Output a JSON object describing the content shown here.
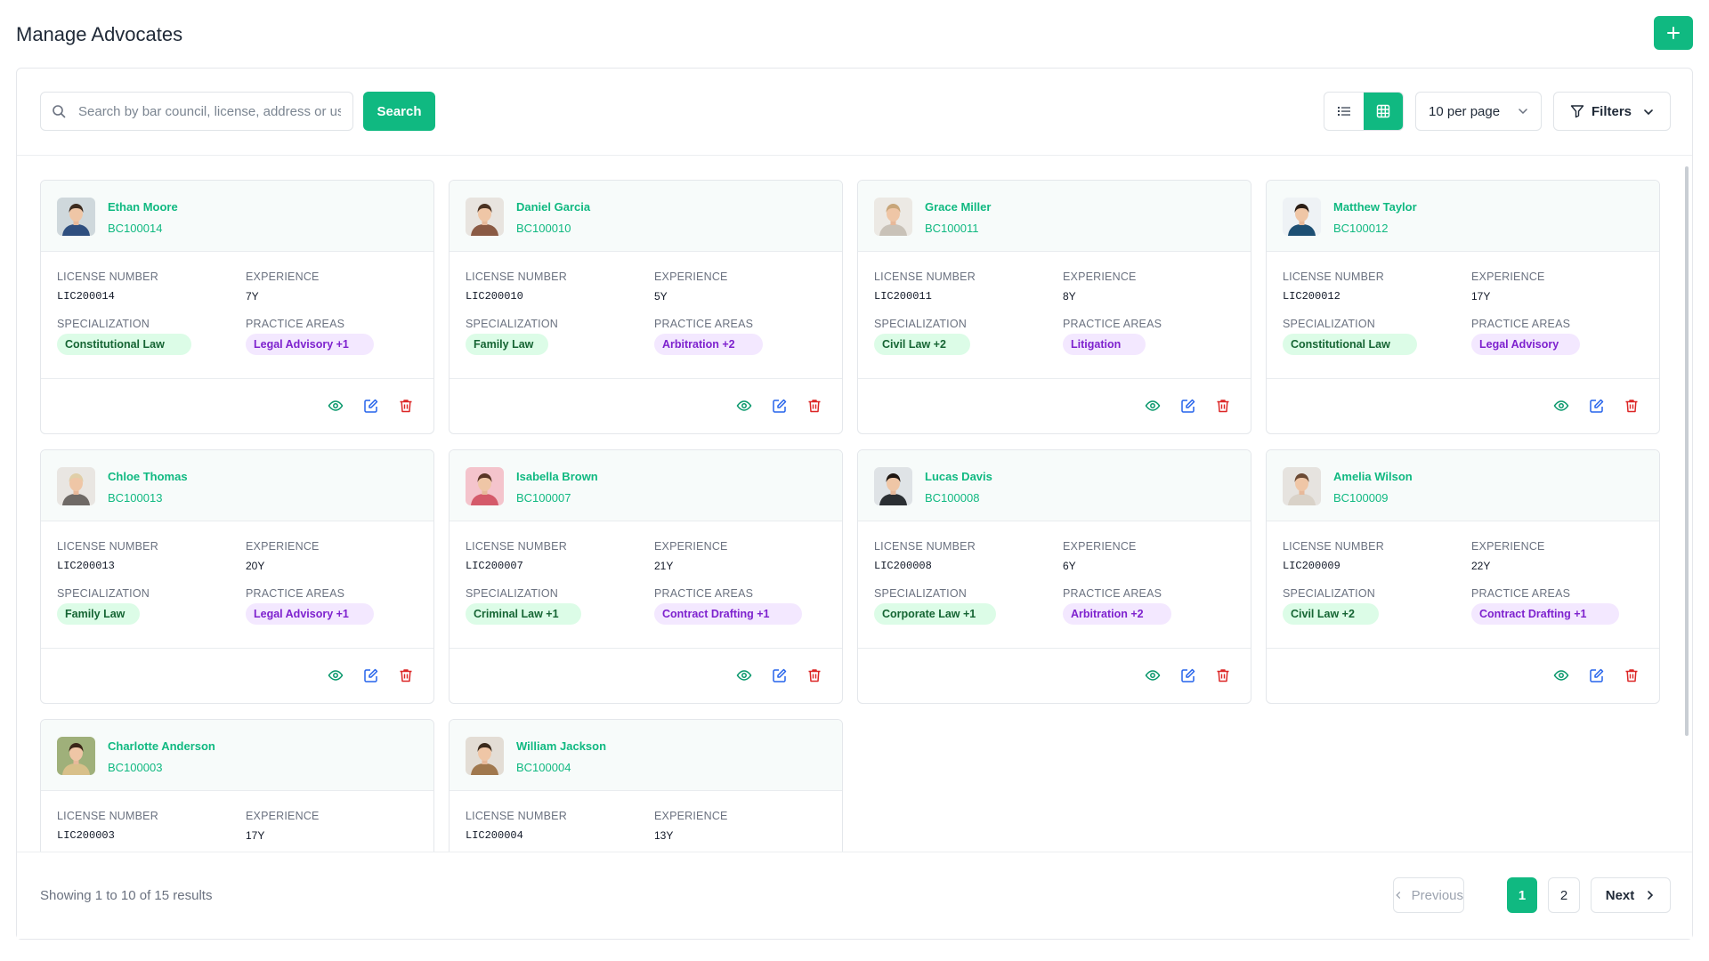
{
  "page": {
    "title": "Manage Advocates"
  },
  "toolbar": {
    "search_placeholder": "Search by bar council, license, address or us",
    "search_label": "Search",
    "per_page": "10 per page",
    "filters_label": "Filters"
  },
  "labels": {
    "license": "LICENSE NUMBER",
    "experience": "EXPERIENCE",
    "specialization": "SPECIALIZATION",
    "practice": "PRACTICE AREAS"
  },
  "advocates": [
    {
      "name": "Ethan Moore",
      "bc": "BC100014",
      "license": "LIC200014",
      "experience": "7Y",
      "specialization": "Constitutional Law",
      "practice": "Legal Advisory +1",
      "avatar_bg": "#cfd8dc",
      "shirt": "#2f4f7f",
      "hair": "#3b2a1e"
    },
    {
      "name": "Daniel Garcia",
      "bc": "BC100010",
      "license": "LIC200010",
      "experience": "5Y",
      "specialization": "Family Law",
      "practice": "Arbitration +2",
      "avatar_bg": "#e8e4df",
      "shirt": "#8a5a44",
      "hair": "#4a3222"
    },
    {
      "name": "Grace Miller",
      "bc": "BC100011",
      "license": "LIC200011",
      "experience": "8Y",
      "specialization": "Civil Law +2",
      "practice": "Litigation",
      "avatar_bg": "#ece9e4",
      "shirt": "#c9c2b8",
      "hair": "#c8a67a"
    },
    {
      "name": "Matthew Taylor",
      "bc": "BC100012",
      "license": "LIC200012",
      "experience": "17Y",
      "specialization": "Constitutional Law",
      "practice": "Legal Advisory",
      "avatar_bg": "#eef2f5",
      "shirt": "#1d4f73",
      "hair": "#2a1e16"
    },
    {
      "name": "Chloe Thomas",
      "bc": "BC100013",
      "license": "LIC200013",
      "experience": "20Y",
      "specialization": "Family Law",
      "practice": "Legal Advisory +1",
      "avatar_bg": "#e9e6e2",
      "shirt": "#6f6a66",
      "hair": "#e0cfa8"
    },
    {
      "name": "Isabella Brown",
      "bc": "BC100007",
      "license": "LIC200007",
      "experience": "21Y",
      "specialization": "Criminal Law +1",
      "practice": "Contract Drafting +1",
      "avatar_bg": "#f4c4cc",
      "shirt": "#d45a6a",
      "hair": "#5a3526"
    },
    {
      "name": "Lucas Davis",
      "bc": "BC100008",
      "license": "LIC200008",
      "experience": "6Y",
      "specialization": "Corporate Law +1",
      "practice": "Arbitration +2",
      "avatar_bg": "#dfe3e6",
      "shirt": "#2b2f33",
      "hair": "#1e1612"
    },
    {
      "name": "Amelia Wilson",
      "bc": "BC100009",
      "license": "LIC200009",
      "experience": "22Y",
      "specialization": "Civil Law +2",
      "practice": "Contract Drafting +1",
      "avatar_bg": "#e6e3df",
      "shirt": "#d9d2c8",
      "hair": "#6b4a34"
    },
    {
      "name": "Charlotte Anderson",
      "bc": "BC100003",
      "license": "LIC200003",
      "experience": "17Y",
      "specialization": "",
      "practice": "",
      "avatar_bg": "#9fb07a",
      "shirt": "#d8c08a",
      "hair": "#3a2618"
    },
    {
      "name": "William Jackson",
      "bc": "BC100004",
      "license": "LIC200004",
      "experience": "13Y",
      "specialization": "",
      "practice": "",
      "avatar_bg": "#e3ddd5",
      "shirt": "#a0784e",
      "hair": "#3a2a1c"
    }
  ],
  "pagination": {
    "showing": "Showing 1 to 10 of 15 results",
    "previous": "Previous",
    "page1": "1",
    "page2": "2",
    "next": "Next"
  },
  "colors": {
    "accent": "#10b981",
    "view": "#059669",
    "edit": "#2563eb",
    "delete": "#dc2626"
  }
}
